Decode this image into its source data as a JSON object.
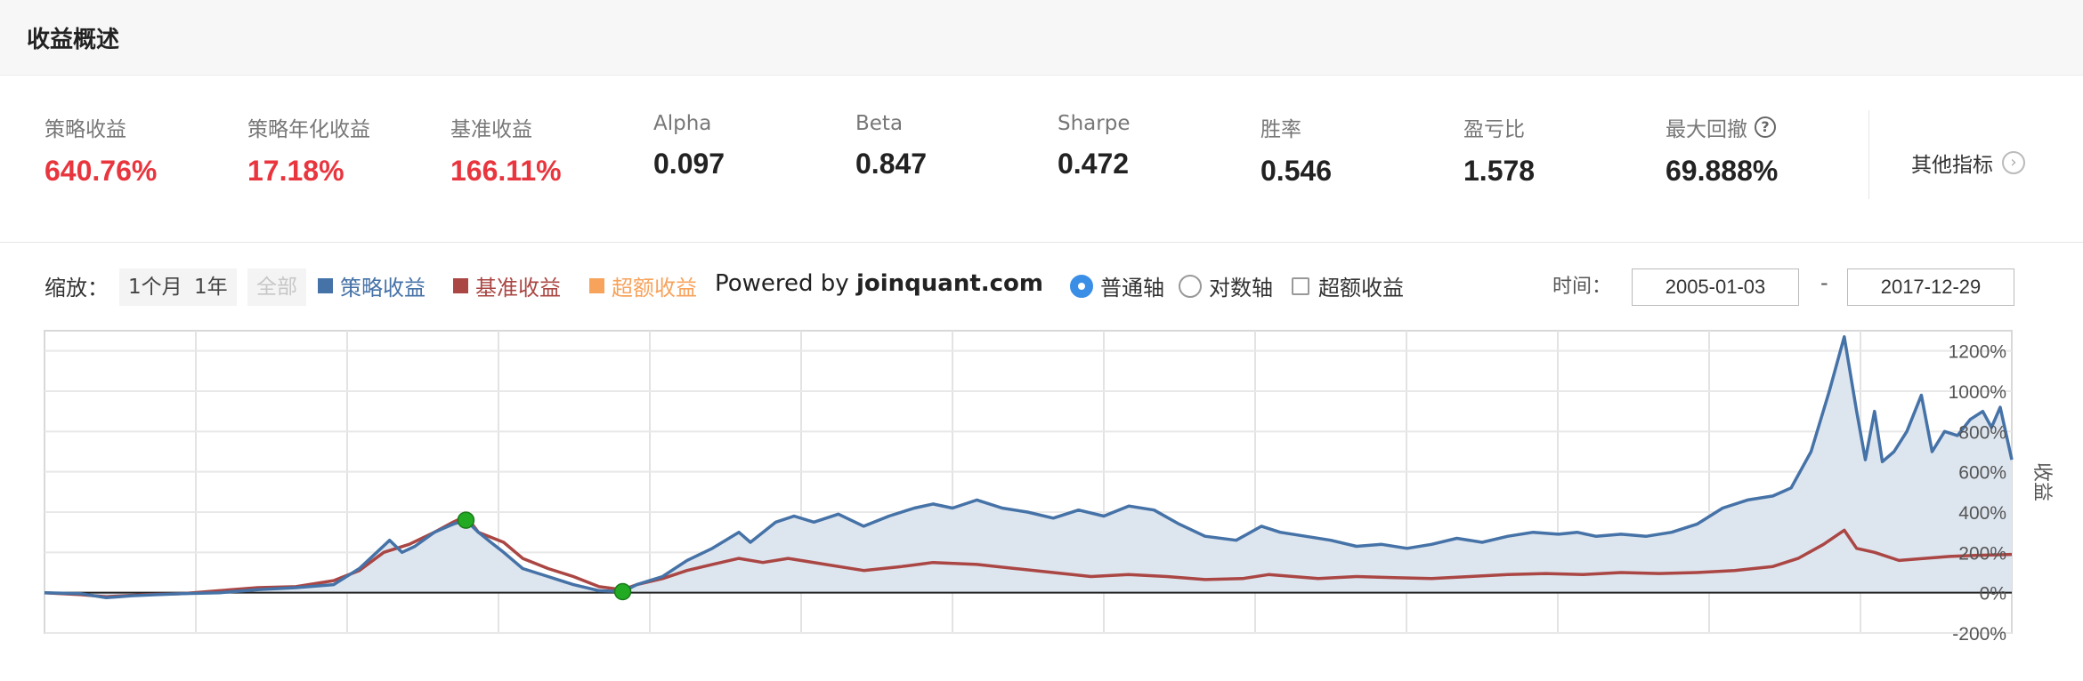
{
  "header": {
    "title": "收益概述"
  },
  "metrics": [
    {
      "label": "策略收益",
      "value": "640.76%",
      "color": "red"
    },
    {
      "label": "策略年化收益",
      "value": "17.18%",
      "color": "red"
    },
    {
      "label": "基准收益",
      "value": "166.11%",
      "color": "red"
    },
    {
      "label": "Alpha",
      "value": "0.097",
      "color": "black"
    },
    {
      "label": "Beta",
      "value": "0.847",
      "color": "black"
    },
    {
      "label": "Sharpe",
      "value": "0.472",
      "color": "black"
    },
    {
      "label": "胜率",
      "value": "0.546",
      "color": "black"
    },
    {
      "label": "盈亏比",
      "value": "1.578",
      "color": "black"
    },
    {
      "label": "最大回撤",
      "value": "69.888%",
      "color": "black",
      "help_icon": "question-circle-icon"
    }
  ],
  "other_metrics": {
    "label": "其他指标",
    "icon": "chevron-right-icon"
  },
  "toolbar": {
    "zoom_label": "缩放：",
    "zoom_buttons": [
      "1个月",
      "1年",
      "全部"
    ],
    "legend": [
      {
        "label": "策略收益",
        "color": "#4572a7"
      },
      {
        "label": "基准收益",
        "color": "#aa4643"
      },
      {
        "label": "超额收益",
        "color": "#f7a35c"
      }
    ],
    "powered_prefix": "Powered by ",
    "powered_site": "joinquant.com",
    "axis_options": [
      {
        "label": "普通轴",
        "selected": true
      },
      {
        "label": "对数轴",
        "selected": false
      }
    ],
    "excess_checkbox": {
      "label": "超额收益",
      "checked": false
    },
    "time_label": "时间：",
    "date_from": "2005-01-03",
    "date_sep": "-",
    "date_to": "2017-12-29"
  },
  "colors": {
    "accent_red": "#e8353e",
    "strategy": "#4572a7",
    "benchmark": "#aa4643",
    "excess": "#f7a35c",
    "radio_accent": "#3a8ee6"
  },
  "chart_data": {
    "type": "area",
    "xlim": [
      "2005-01-03",
      "2017-12-29"
    ],
    "ylim": [
      -200,
      1300
    ],
    "yticks": [
      -200,
      0,
      200,
      400,
      600,
      800,
      1000,
      1200
    ],
    "ytick_labels": [
      "-200%",
      "0%",
      "200%",
      "400%",
      "600%",
      "800%",
      "1000%",
      "1200%"
    ],
    "ylabel": "收益",
    "grid": true,
    "series": [
      {
        "name": "策略收益",
        "color": "#4572a7",
        "fill": true,
        "points": [
          [
            "2005-01-03",
            0
          ],
          [
            "2005-04-01",
            -5
          ],
          [
            "2005-06-01",
            -25
          ],
          [
            "2005-08-01",
            -15
          ],
          [
            "2005-10-01",
            -10
          ],
          [
            "2005-12-01",
            -5
          ],
          [
            "2006-03-01",
            0
          ],
          [
            "2006-06-01",
            15
          ],
          [
            "2006-09-01",
            25
          ],
          [
            "2006-12-01",
            40
          ],
          [
            "2007-02-01",
            120
          ],
          [
            "2007-03-15",
            200
          ],
          [
            "2007-04-15",
            260
          ],
          [
            "2007-05-15",
            200
          ],
          [
            "2007-06-15",
            230
          ],
          [
            "2007-08-01",
            300
          ],
          [
            "2007-09-15",
            340
          ],
          [
            "2007-10-16",
            360
          ],
          [
            "2007-11-15",
            300
          ],
          [
            "2007-12-15",
            250
          ],
          [
            "2008-01-15",
            200
          ],
          [
            "2008-03-01",
            120
          ],
          [
            "2008-05-01",
            80
          ],
          [
            "2008-07-01",
            40
          ],
          [
            "2008-09-01",
            10
          ],
          [
            "2008-10-28",
            5
          ],
          [
            "2008-12-01",
            40
          ],
          [
            "2009-02-01",
            80
          ],
          [
            "2009-04-01",
            160
          ],
          [
            "2009-06-01",
            220
          ],
          [
            "2009-08-04",
            300
          ],
          [
            "2009-09-01",
            250
          ],
          [
            "2009-11-01",
            350
          ],
          [
            "2009-12-15",
            380
          ],
          [
            "2010-02-01",
            350
          ],
          [
            "2010-04-01",
            390
          ],
          [
            "2010-06-01",
            330
          ],
          [
            "2010-08-01",
            380
          ],
          [
            "2010-10-01",
            420
          ],
          [
            "2010-11-15",
            440
          ],
          [
            "2011-01-01",
            420
          ],
          [
            "2011-03-01",
            460
          ],
          [
            "2011-05-01",
            420
          ],
          [
            "2011-07-01",
            400
          ],
          [
            "2011-09-01",
            370
          ],
          [
            "2011-11-01",
            410
          ],
          [
            "2012-01-01",
            380
          ],
          [
            "2012-03-01",
            430
          ],
          [
            "2012-05-01",
            410
          ],
          [
            "2012-07-01",
            340
          ],
          [
            "2012-09-01",
            280
          ],
          [
            "2012-11-15",
            260
          ],
          [
            "2013-01-15",
            330
          ],
          [
            "2013-03-01",
            300
          ],
          [
            "2013-05-01",
            280
          ],
          [
            "2013-07-01",
            260
          ],
          [
            "2013-09-01",
            230
          ],
          [
            "2013-11-01",
            240
          ],
          [
            "2014-01-01",
            220
          ],
          [
            "2014-03-01",
            240
          ],
          [
            "2014-05-01",
            270
          ],
          [
            "2014-07-01",
            250
          ],
          [
            "2014-09-01",
            280
          ],
          [
            "2014-11-01",
            300
          ],
          [
            "2015-01-01",
            290
          ],
          [
            "2015-02-15",
            300
          ],
          [
            "2015-04-01",
            280
          ],
          [
            "2015-06-01",
            290
          ],
          [
            "2015-08-01",
            280
          ],
          [
            "2015-10-01",
            300
          ],
          [
            "2015-12-01",
            340
          ],
          [
            "2016-02-01",
            420
          ],
          [
            "2016-04-01",
            460
          ],
          [
            "2016-06-01",
            480
          ],
          [
            "2016-07-15",
            520
          ],
          [
            "2016-09-01",
            700
          ],
          [
            "2016-10-15",
            1000
          ],
          [
            "2016-11-20",
            1270
          ],
          [
            "2016-12-20",
            900
          ],
          [
            "2017-01-10",
            660
          ],
          [
            "2017-02-01",
            900
          ],
          [
            "2017-02-20",
            650
          ],
          [
            "2017-03-20",
            700
          ],
          [
            "2017-04-20",
            800
          ],
          [
            "2017-05-25",
            980
          ],
          [
            "2017-06-20",
            700
          ],
          [
            "2017-07-20",
            800
          ],
          [
            "2017-08-20",
            780
          ],
          [
            "2017-09-20",
            860
          ],
          [
            "2017-10-20",
            900
          ],
          [
            "2017-11-10",
            820
          ],
          [
            "2017-12-01",
            920
          ],
          [
            "2017-12-29",
            660
          ]
        ]
      },
      {
        "name": "基准收益",
        "color": "#aa4643",
        "fill": false,
        "points": [
          [
            "2005-01-03",
            0
          ],
          [
            "2005-04-01",
            -10
          ],
          [
            "2005-06-01",
            -20
          ],
          [
            "2005-09-01",
            -10
          ],
          [
            "2005-12-01",
            -5
          ],
          [
            "2006-03-01",
            10
          ],
          [
            "2006-06-01",
            25
          ],
          [
            "2006-09-01",
            30
          ],
          [
            "2006-12-01",
            60
          ],
          [
            "2007-02-01",
            110
          ],
          [
            "2007-04-01",
            200
          ],
          [
            "2007-06-01",
            240
          ],
          [
            "2007-08-01",
            300
          ],
          [
            "2007-09-15",
            350
          ],
          [
            "2007-10-16",
            380
          ],
          [
            "2007-11-15",
            300
          ],
          [
            "2008-01-15",
            250
          ],
          [
            "2008-03-01",
            170
          ],
          [
            "2008-05-01",
            120
          ],
          [
            "2008-07-01",
            80
          ],
          [
            "2008-09-01",
            30
          ],
          [
            "2008-10-28",
            15
          ],
          [
            "2008-12-01",
            40
          ],
          [
            "2009-02-01",
            70
          ],
          [
            "2009-04-01",
            110
          ],
          [
            "2009-06-01",
            140
          ],
          [
            "2009-08-04",
            170
          ],
          [
            "2009-10-01",
            150
          ],
          [
            "2009-12-01",
            170
          ],
          [
            "2010-03-01",
            140
          ],
          [
            "2010-06-01",
            110
          ],
          [
            "2010-09-01",
            130
          ],
          [
            "2010-11-15",
            150
          ],
          [
            "2011-03-01",
            140
          ],
          [
            "2011-06-01",
            120
          ],
          [
            "2011-09-01",
            100
          ],
          [
            "2011-12-01",
            80
          ],
          [
            "2012-03-01",
            90
          ],
          [
            "2012-06-01",
            80
          ],
          [
            "2012-09-01",
            65
          ],
          [
            "2012-12-01",
            70
          ],
          [
            "2013-02-01",
            90
          ],
          [
            "2013-06-01",
            70
          ],
          [
            "2013-09-01",
            80
          ],
          [
            "2013-12-01",
            75
          ],
          [
            "2014-03-01",
            70
          ],
          [
            "2014-06-01",
            80
          ],
          [
            "2014-09-01",
            90
          ],
          [
            "2014-12-01",
            95
          ],
          [
            "2015-03-01",
            90
          ],
          [
            "2015-06-01",
            100
          ],
          [
            "2015-09-01",
            95
          ],
          [
            "2015-12-01",
            100
          ],
          [
            "2016-03-01",
            110
          ],
          [
            "2016-06-01",
            130
          ],
          [
            "2016-08-01",
            170
          ],
          [
            "2016-10-01",
            240
          ],
          [
            "2016-11-20",
            310
          ],
          [
            "2016-12-20",
            220
          ],
          [
            "2017-02-01",
            200
          ],
          [
            "2017-04-01",
            160
          ],
          [
            "2017-06-01",
            170
          ],
          [
            "2017-08-01",
            180
          ],
          [
            "2017-10-01",
            185
          ],
          [
            "2017-12-29",
            190
          ]
        ]
      }
    ],
    "markers": [
      {
        "x": "2007-10-16",
        "y": 360,
        "color": "#22aa22"
      },
      {
        "x": "2008-10-28",
        "y": 5,
        "color": "#22aa22"
      }
    ]
  }
}
